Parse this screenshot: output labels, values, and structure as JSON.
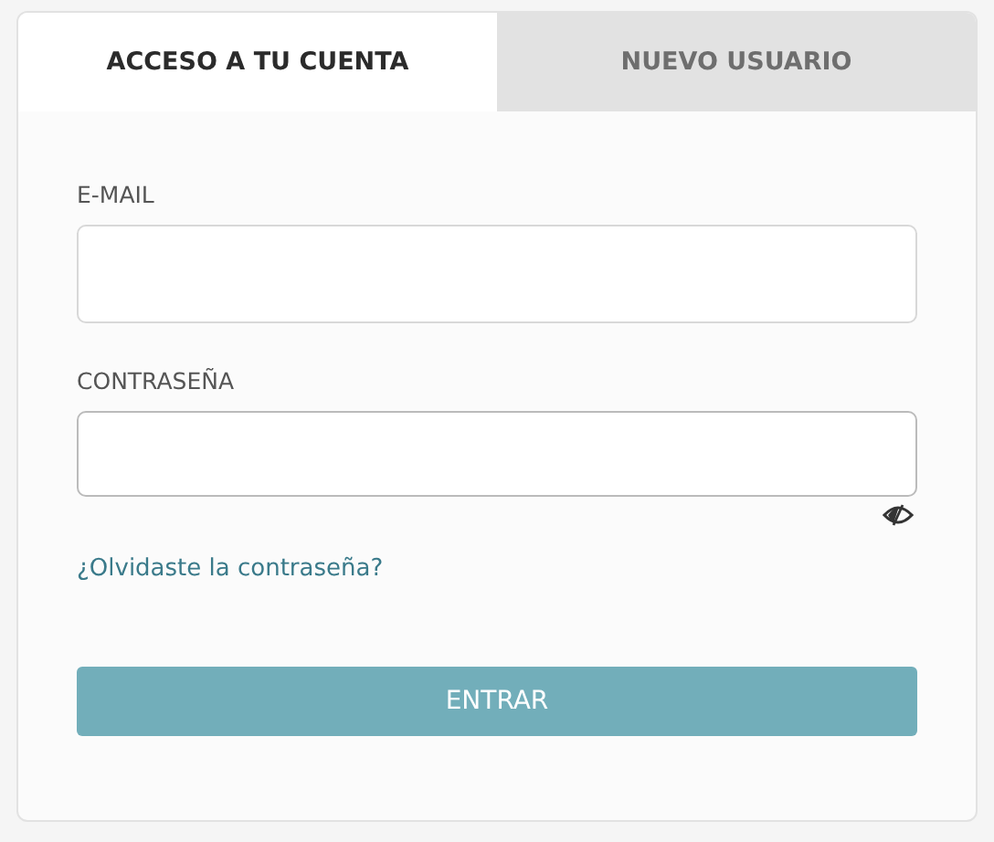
{
  "tabs": [
    {
      "label": "ACCESO A TU CUENTA",
      "selected": true
    },
    {
      "label": "NUEVO USUARIO",
      "selected": false
    }
  ],
  "fields": [
    {
      "label": "E-MAIL",
      "kind": "text"
    },
    {
      "label": "CONTRASEÑA",
      "kind": "password"
    }
  ],
  "forgot_link": "¿Olvidaste la contraseña?",
  "submit_button": "ENTRAR"
}
